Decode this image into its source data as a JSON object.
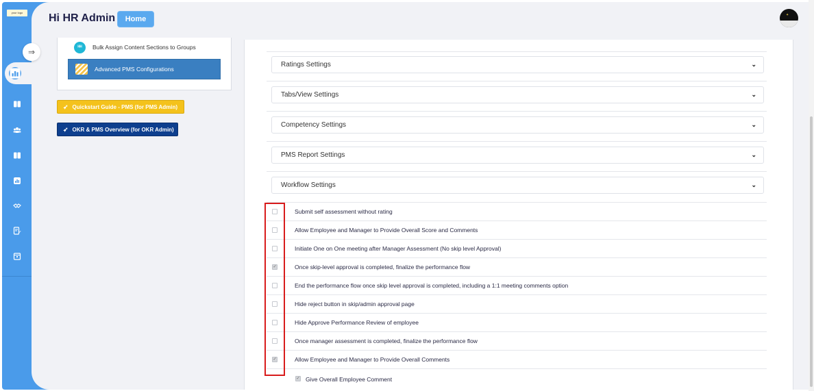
{
  "sidebar": {
    "logo_text": "your logo",
    "icons": [
      "collapse-arrow-icon",
      "chart-icon",
      "book-icon",
      "users-icon",
      "book-open-icon",
      "report-icon",
      "handshake-icon",
      "edit-doc-icon",
      "calendar-icon"
    ]
  },
  "header": {
    "title": "Hi HR Admin",
    "home_label": "Home"
  },
  "left_panel": {
    "bulk_label": "Bulk Assign Content Sections to Groups",
    "advanced_label": "Advanced PMS Configurations",
    "quickstart_label": "Quickstart Guide - PMS (for PMS Admin)",
    "okr_label": "OKR & PMS Overview (for OKR Admin)"
  },
  "accordions": [
    {
      "label": "Ratings Settings"
    },
    {
      "label": "Tabs/View Settings"
    },
    {
      "label": "Competency Settings"
    },
    {
      "label": "PMS Report Settings"
    },
    {
      "label": "Workflow Settings"
    }
  ],
  "options": [
    {
      "label": "Submit self assessment without rating",
      "checked": false
    },
    {
      "label": "Allow Employee and Manager to Provide Overall Score and Comments",
      "checked": false
    },
    {
      "label": "Initiate One on One meeting after Manager Assessment (No skip level Approval)",
      "checked": false
    },
    {
      "label": "Once skip-level approval is completed, finalize the performance flow",
      "checked": true
    },
    {
      "label": "End the performance flow once skip level approval is completed, including a 1:1 meeting comments option",
      "checked": false
    },
    {
      "label": "Hide reject button in skip/admin approval page",
      "checked": false
    },
    {
      "label": "Hide Approve Performance Review of employee",
      "checked": false
    },
    {
      "label": "Once manager assessment is completed, finalize the performance flow",
      "checked": false
    },
    {
      "label": "Allow Employee and Manager to Provide Overall Comments",
      "checked": true
    }
  ],
  "sub_option": {
    "label": "Give Overall Employee Comment",
    "checked": true
  },
  "colors": {
    "sidebar": "#4a9bea",
    "panel": "#f1f2f6",
    "quickstart": "#f4c21c",
    "okr": "#0e3f8e",
    "advanced": "#3a7fc1",
    "highlight": "#d81b1b"
  }
}
